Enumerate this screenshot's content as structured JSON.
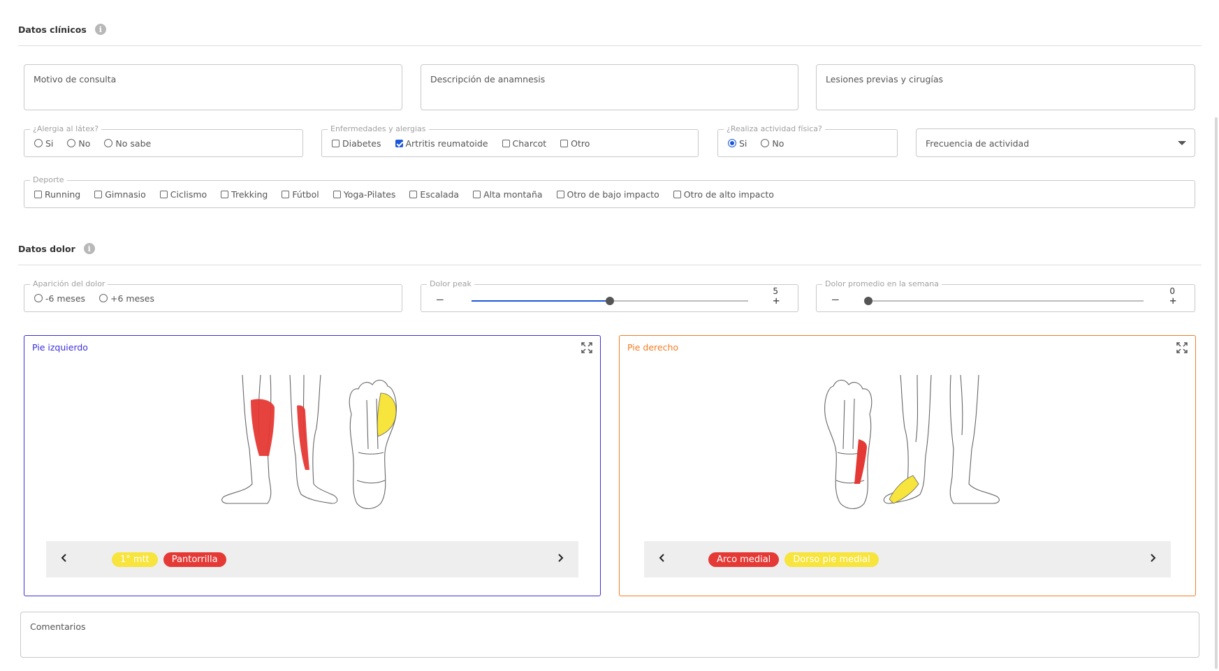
{
  "clinical": {
    "title": "Datos clínicos",
    "info_glyph": "i",
    "motivo": "Motivo de consulta",
    "anamnesis": "Descripción de anamnesis",
    "lesiones": "Lesiones previas y cirugías",
    "latex": {
      "legend": "¿Alergia al látex?",
      "options": [
        "Si",
        "No",
        "No sabe"
      ],
      "selected": null
    },
    "enfermedades": {
      "legend": "Enfermedades y alergias",
      "options": [
        "Diabetes",
        "Artritis reumatoide",
        "Charcot",
        "Otro"
      ],
      "checked": [
        "Artritis reumatoide"
      ]
    },
    "actividad": {
      "legend": "¿Realiza actividad física?",
      "options": [
        "Si",
        "No"
      ],
      "selected": "Si"
    },
    "frecuencia": "Frecuencia de actividad",
    "deporte": {
      "legend": "Deporte",
      "options": [
        "Running",
        "Gimnasio",
        "Ciclismo",
        "Trekking",
        "Fútbol",
        "Yoga-Pilates",
        "Escalada",
        "Alta montaña",
        "Otro de bajo impacto",
        "Otro de alto impacto"
      ]
    }
  },
  "pain": {
    "title": "Datos dolor",
    "info_glyph": "i",
    "aparicion": {
      "legend": "Aparición del dolor",
      "options": [
        "-6 meses",
        "+6 meses"
      ]
    },
    "peak": {
      "legend": "Dolor peak",
      "value": "5",
      "min": 0,
      "max": 10,
      "minus": "–",
      "plus": "+"
    },
    "promedio": {
      "legend": "Dolor promedio en la semana",
      "value": "0",
      "min": 0,
      "max": 10,
      "minus": "–",
      "plus": "+"
    }
  },
  "feet": {
    "left": {
      "title": "Pie izquierdo",
      "color": "#3b2fd9",
      "tags": [
        {
          "label": "1° mtt",
          "color": "yellow"
        },
        {
          "label": "Pantorrilla",
          "color": "red"
        }
      ]
    },
    "right": {
      "title": "Pie derecho",
      "color": "#f57c23",
      "tags": [
        {
          "label": "Arco medial",
          "color": "red"
        },
        {
          "label": "Dorso pie medial",
          "color": "yellow"
        }
      ]
    }
  },
  "comentarios": "Comentarios"
}
